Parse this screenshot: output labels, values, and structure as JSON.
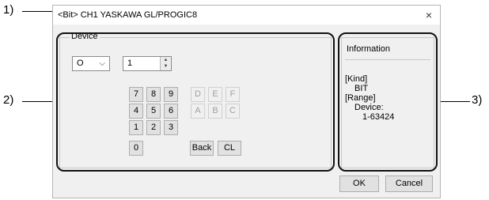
{
  "callouts": {
    "c1": "1)",
    "c2": "2)",
    "c3": "3)"
  },
  "dialog": {
    "title": "<Bit> CH1 YASKAWA GL/PROGIC8",
    "close": "×",
    "device_group": {
      "label": "Device",
      "device_type": "O",
      "device_number": "1"
    },
    "keypad": {
      "digits": [
        "7",
        "8",
        "9",
        "4",
        "5",
        "6",
        "1",
        "2",
        "3",
        "0"
      ],
      "hex": [
        "D",
        "E",
        "F",
        "A",
        "B",
        "C"
      ],
      "back": "Back",
      "clear": "CL"
    },
    "information": {
      "title": "Information",
      "kind_label": "[Kind]",
      "kind_value": "BIT",
      "range_label": "[Range]",
      "device_label": "Device:",
      "range_value": "1-63424"
    },
    "ok": "OK",
    "cancel": "Cancel"
  }
}
